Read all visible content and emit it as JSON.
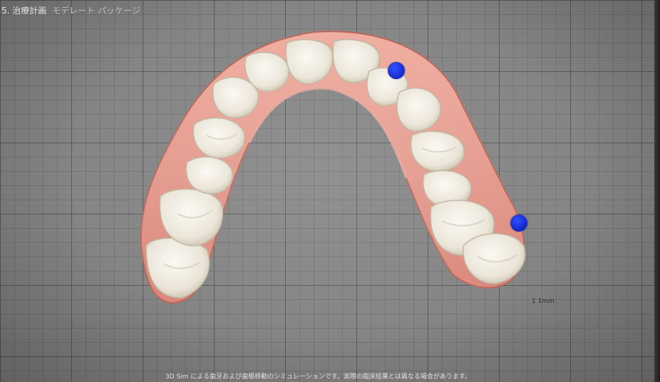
{
  "header": {
    "step": "5. 治療計画",
    "package": "モデレート パッケージ"
  },
  "scale_label": "1 1mm",
  "disclaimer": "3D Sim による歯牙および歯根移動のシミュレーションです。実際の臨床結果とは異なる場合があります。",
  "markers": [
    {
      "name": "attachment-marker-upper",
      "color": "#1a35e0"
    },
    {
      "name": "attachment-marker-right",
      "color": "#1a35e0"
    }
  ],
  "colors": {
    "gum": "#e8a093",
    "gum_dark": "#c96f62",
    "tooth": "#f3efe6",
    "tooth_shade": "#cfc8b8",
    "grid_bg": "#858585"
  }
}
